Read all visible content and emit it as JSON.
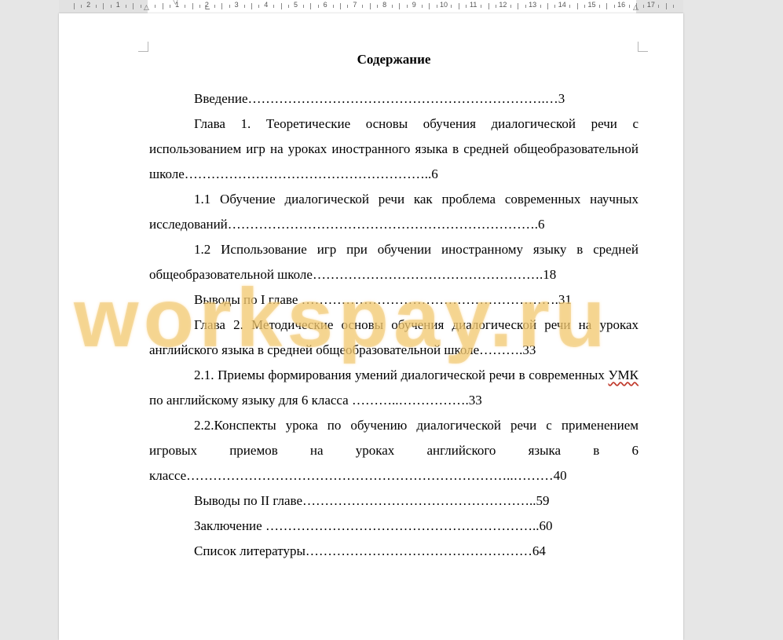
{
  "ruler": {
    "numbers": [
      "2",
      "1",
      "1",
      "2",
      "3",
      "4",
      "5",
      "6",
      "7",
      "8",
      "9",
      "10",
      "11",
      "12",
      "13",
      "14",
      "15",
      "16",
      "17"
    ]
  },
  "document": {
    "title": "Содержание",
    "toc": [
      {
        "text": "Введение………………………………………………………….…3"
      },
      {
        "text": "Глава 1. Теоретические основы обучения диалогической речи с использованием игр на уроках иностранного языка в средней общеобразовательной школе………………………………………………..6"
      },
      {
        "text": "1.1 Обучение диалогической речи как проблема современных научных исследований…………………………………………………………….6"
      },
      {
        "text": "1.2 Использование игр при обучении иностранному языку в средней общеобразовательной школе…………………………………………….18"
      },
      {
        "text": "Выводы по I главе ………………………………………………….31"
      },
      {
        "text": "Глава 2. Методические основы обучения диалогической речи на уроках английского языка в средней общеобразовательной школе……….33"
      },
      {
        "text_before": "2.1. Приемы формирования умений диалогической речи в современных ",
        "underlined": "УМК",
        "text_after": " по английскому языку для 6 класса ………..…………….33"
      },
      {
        "text": "2.2.Конспекты урока по обучению диалогической речи с применением игровых приемов на уроках английского языка в 6 классе………………………………………………………………..………40"
      },
      {
        "text": "Выводы по II главе……………………………………………..59"
      },
      {
        "text": "Заключение ……………………………………………………..60"
      },
      {
        "text": "Список литературы……………………………………………64"
      }
    ]
  },
  "watermark": {
    "text": "workspay.ru",
    "color": "#ecc46e"
  },
  "colors": {
    "background": "#e6e6e6",
    "page": "#ffffff",
    "text": "#000000"
  }
}
